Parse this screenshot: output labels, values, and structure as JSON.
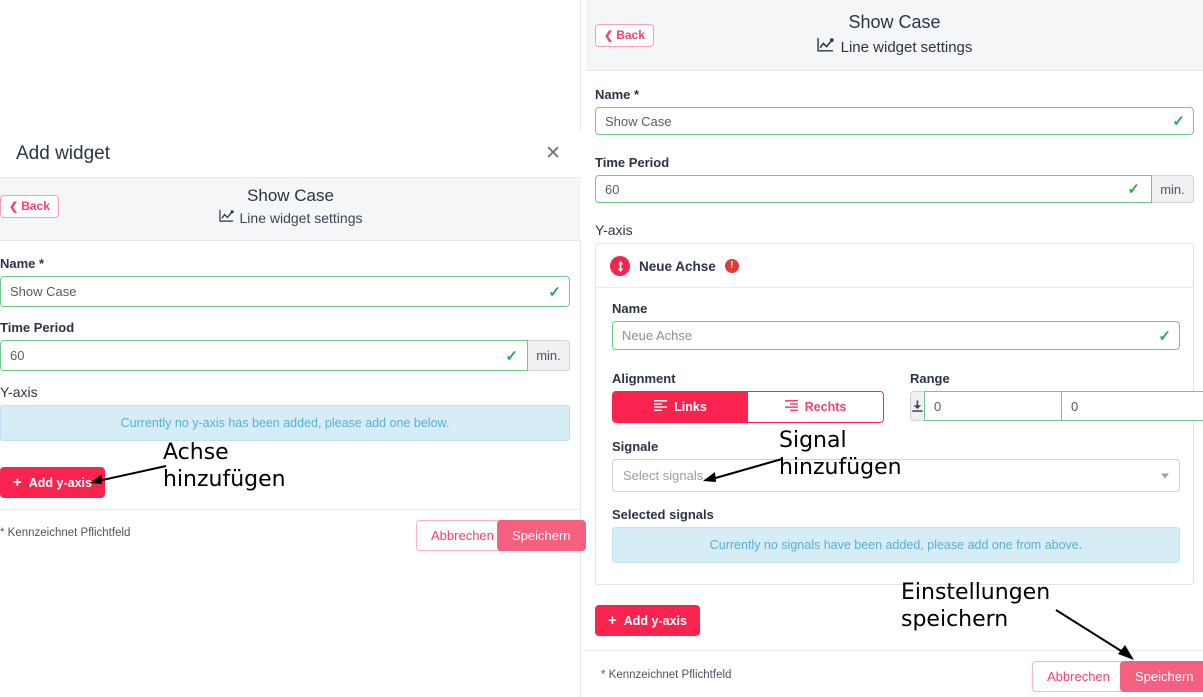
{
  "left_panel": {
    "modal_title": "Add widget",
    "close_icon": "close-icon",
    "back_label": "Back",
    "header_title": "Show Case",
    "header_subtitle": "Line widget settings",
    "header_subtitle_icon": "line-chart-icon",
    "name_label": "Name *",
    "name_value": "Show Case",
    "time_period_label": "Time Period",
    "time_period_value": "60",
    "time_period_unit": "min.",
    "yaxis_label": "Y-axis",
    "yaxis_empty_message": "Currently no y-axis has been added, please add one below.",
    "add_yaxis_label": "Add y-axis",
    "required_note": "* Kennzeichnet Pflichtfeld",
    "cancel_label": "Abbrechen",
    "save_label": "Speichern"
  },
  "right_panel": {
    "back_label": "Back",
    "header_title": "Show Case",
    "header_subtitle": "Line widget settings",
    "header_subtitle_icon": "line-chart-icon",
    "name_label": "Name *",
    "name_value": "Show Case",
    "time_period_label": "Time Period",
    "time_period_value": "60",
    "time_period_unit": "min.",
    "yaxis_label": "Y-axis",
    "axis_card": {
      "drag_icon": "updown-arrows-icon",
      "title": "Neue Achse",
      "warning_icon": "warning-exclamation-icon",
      "name_label": "Name",
      "name_placeholder": "Neue Achse",
      "alignment_label": "Alignment",
      "alignment_left_label": "Links",
      "alignment_left_icon": "align-left-icon",
      "alignment_right_label": "Rechts",
      "alignment_right_icon": "align-right-icon",
      "range_label": "Range",
      "range_min_icon": "arrow-down-to-line-icon",
      "range_min_value": "0",
      "range_max_icon": "arrow-up-to-line-icon",
      "range_max_value": "0",
      "signals_label": "Signale",
      "signals_placeholder": "Select signals...",
      "selected_signals_label": "Selected signals",
      "selected_signals_empty": "Currently no signals have been added, please add one from above."
    },
    "add_yaxis_label": "Add y-axis",
    "required_note": "* Kennzeichnet Pflichtfeld",
    "cancel_label": "Abbrechen",
    "save_label": "Speichern"
  },
  "annotations": {
    "achse_hinzufuegen": "Achse\nhinzufügen",
    "signal_hinzufuegen": "Signal\nhinzufügen",
    "einstellungen_speichern": "Einstellungen\nspeichern"
  },
  "colors": {
    "accent_red": "#f8244f",
    "accent_pink": "#f4607f",
    "valid_green": "#2fa84f",
    "info_blue": "#59aed6",
    "info_bg": "#d7edf6",
    "header_bg": "#f5f6f8"
  }
}
